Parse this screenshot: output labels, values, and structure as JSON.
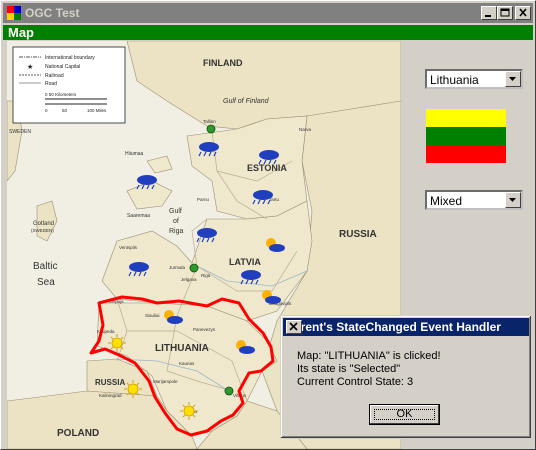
{
  "window": {
    "title": "OGC Test"
  },
  "panel": {
    "title": "Map"
  },
  "country_select": {
    "value": "Lithuania"
  },
  "mode_select": {
    "value": "Mixed"
  },
  "flag": {
    "colors": [
      "#ffff00",
      "#008000",
      "#ff0000"
    ]
  },
  "map": {
    "seas": [
      "Baltic",
      "Sea",
      "Gulf of Finland",
      "Gulf",
      "of",
      "Riga"
    ],
    "countries": [
      "FINLAND",
      "ESTONIA",
      "LATVIA",
      "LITHUANIA",
      "RUSSIA",
      "POLAND",
      "SWEDEN",
      "RUSSIA"
    ],
    "islands": [
      "Gotland",
      "(SWEDEN)",
      "Hiiumaa",
      "Saaremaa"
    ],
    "cities": [
      "Tallinn",
      "Riga",
      "Vilnius",
      "Kaunas",
      "Klaipeda",
      "Siauliai",
      "Panevezys",
      "Daugavpils",
      "Tartu",
      "Parnu",
      "Liepaja",
      "Ventspils",
      "Marijampole",
      "Alytus",
      "Kaliningrad",
      "Jelgava",
      "Jurmala",
      "Narva"
    ],
    "highlight_color": "#ff0000",
    "legend": {
      "items": [
        "International boundary",
        "National Capital",
        "Railroad",
        "Road"
      ],
      "scale_title": "0  50 Kilometers",
      "scale_ticks": [
        "0",
        "50",
        "100 Miles"
      ]
    }
  },
  "dialog": {
    "title": "Parent's StateChanged Event Handler",
    "line1": "Map:  \"LITHUANIA\" is clicked!",
    "line2": "Its state is \"Selected\"",
    "line3": "Current Control State: 3",
    "ok_label": "OK"
  }
}
